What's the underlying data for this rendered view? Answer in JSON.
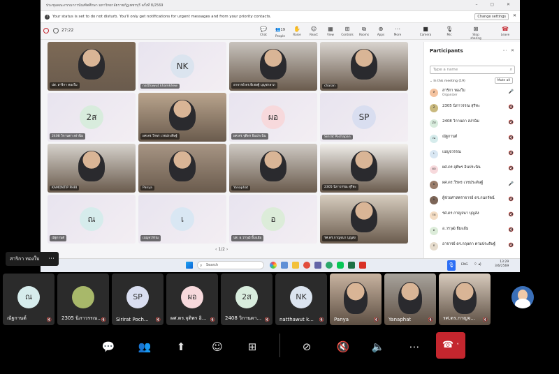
{
  "window": {
    "title": "ประชุมคณะกรรมการบัณฑิตศึกษา มหาวิทยาลัยราชภัฏเพชรบุรี ครั้งที่ 8/2569"
  },
  "dnd": {
    "message": "Your status is set to do not disturb. You'll only get notifications for urgent messages and from your priority contacts.",
    "change_label": "Change settings"
  },
  "meeting": {
    "timer": "27:22"
  },
  "toolbar": {
    "chat": "Chat",
    "people": "People",
    "people_count": "19",
    "raise": "Raise",
    "react": "React",
    "view": "View",
    "controls": "Controls",
    "rooms": "Rooms",
    "apps": "Apps",
    "more": "More",
    "camera": "Camera",
    "mic": "Mic",
    "stop_sharing": "Stop sharing",
    "leave": "Leave"
  },
  "tiles": [
    {
      "name": "ปส. สาริกา ทองใบ",
      "kind": "video"
    },
    {
      "name": "natthawut khamkhew",
      "initials": "NK",
      "kind": "avatar",
      "color": "#dbe4ef"
    },
    {
      "name": "อาจารย์ ดร.พิเชษฐ์ บุญชาลาภ",
      "kind": "video"
    },
    {
      "name": "charan",
      "kind": "video"
    },
    {
      "name": "2408 วิกานดา สง่าฉิม",
      "initials": "2ส",
      "kind": "avatar",
      "color": "#d8ecdd"
    },
    {
      "name": "ผศ.ดร.วีรพร เวชประดิษฐ์",
      "kind": "video"
    },
    {
      "name": "ผศ.ดร.จุติพร อินประนิน",
      "initials": "ผอ",
      "kind": "avatar",
      "color": "#f7d9dc"
    },
    {
      "name": "Sirirat Pochapan",
      "initials": "SP",
      "kind": "avatar",
      "color": "#d9def0"
    },
    {
      "name": "KAMONTIP PHRI",
      "kind": "video"
    },
    {
      "name": "Panya",
      "kind": "video"
    },
    {
      "name": "Yanaphat",
      "kind": "video"
    },
    {
      "name": "2305 นิภาวรรณ สุริทะ",
      "kind": "video"
    },
    {
      "name": "ณัฐกานต์",
      "initials": "ณ",
      "kind": "avatar",
      "color": "#d6ecec"
    },
    {
      "name": "เบญจวรรณ",
      "initials": "เ",
      "kind": "avatar",
      "color": "#d9e7f3"
    },
    {
      "name": "ปส. ผ.วรวุฒิ ยิ้มแย้ม",
      "initials": "อ",
      "kind": "avatar",
      "color": "#dcecd9"
    },
    {
      "name": "รศ.ดร.กาญจนา บุญส่ง",
      "kind": "video"
    }
  ],
  "pager": "1/2",
  "panel": {
    "title": "Participants",
    "search_placeholder": "Type a name",
    "in_meeting": "In this meeting (19)",
    "mute_all": "Mute all",
    "people": [
      {
        "name": "สาริกา ทองใบ",
        "role": "Organizer",
        "initials": "ส",
        "color": "#f4c3a0",
        "mic": "🎤"
      },
      {
        "name": "2305 นิภาวรรณ สุริทะ",
        "initials": "2",
        "color": "#c9b97e",
        "mic": "🔇"
      },
      {
        "name": "2408 วิกานดา สง่าฉิม",
        "initials": "2ส",
        "color": "#d8ecdd",
        "mic": "🔇"
      },
      {
        "name": "ณัฐกานต์",
        "initials": "ณ",
        "color": "#d6ecec",
        "mic": "🔇"
      },
      {
        "name": "เบญจวรรณ",
        "initials": "เ",
        "color": "#d9e7f3",
        "mic": "🔇"
      },
      {
        "name": "ผศ.ดร.จุติพร อินประนิน",
        "initials": "ผอ",
        "color": "#f7d9dc",
        "mic": "🔇"
      },
      {
        "name": "ผศ.ดร.วีรพร เวชประดิษฐ์",
        "initials": "ผ",
        "color": "#9a7d6b",
        "mic": "🎤"
      },
      {
        "name": "ผู้ช่วยศาสตราจารย์ ดร.กนกรัตน์",
        "initials": "ผ",
        "color": "#7c6557",
        "mic": "🔇"
      },
      {
        "name": "รศ.ดร.กาญจนา บุญส่ง",
        "initials": "รบ",
        "color": "#f4ddc4",
        "mic": "🔇"
      },
      {
        "name": "อ.วรวุฒิ ยิ้มแย้ม",
        "initials": "อ",
        "color": "#dcecd9",
        "mic": "🔇"
      },
      {
        "name": "อาจารย์ ดร.กฤษดา ตามประดิษฐ์",
        "initials": "อ",
        "color": "#e6dccd",
        "mic": "🔇"
      }
    ]
  },
  "taskbar": {
    "search": "Search",
    "lang": "ENG",
    "time": "13:29",
    "date": "3/6/2569"
  },
  "presenter": {
    "name": "สาริกา ทองใบ"
  },
  "strip": [
    {
      "name": "ณัฐกานต์",
      "initials": "ณ",
      "color": "#d6ecec",
      "kind": "avatar"
    },
    {
      "name": "2305 นิภาวรรณ...",
      "initials": "",
      "color": "#a8b86a",
      "kind": "image"
    },
    {
      "name": "Sirirat Poch...",
      "initials": "SP",
      "color": "#d9def0",
      "kind": "avatar"
    },
    {
      "name": "ผศ.ดร.จุติพร อิ...",
      "initials": "ผอ",
      "color": "#f7d9dc",
      "kind": "avatar"
    },
    {
      "name": "2408 วิกานดา...",
      "initials": "2ส",
      "color": "#d8ecdd",
      "kind": "avatar"
    },
    {
      "name": "natthawut k...",
      "initials": "NK",
      "color": "#dbe4ef",
      "kind": "avatar"
    },
    {
      "name": "Panya",
      "kind": "video"
    },
    {
      "name": "Yanaphat",
      "kind": "video"
    },
    {
      "name": "รศ.ดร.กาญจ...",
      "kind": "video"
    }
  ]
}
